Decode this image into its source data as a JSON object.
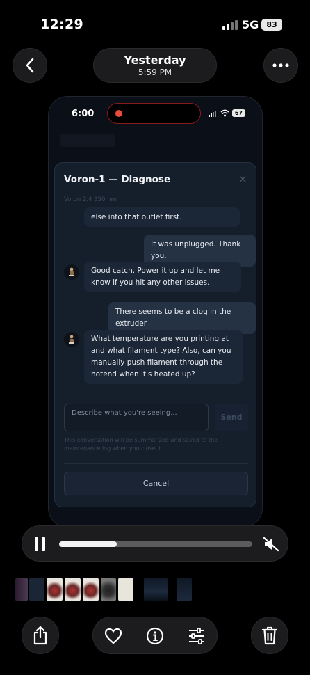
{
  "status_bar": {
    "time": "12:29",
    "network": "5G",
    "battery": "83"
  },
  "header": {
    "title": "Yesterday",
    "subtitle": "5:59 PM"
  },
  "icons": {
    "back": "chevron-left-icon",
    "more": "ellipsis-icon",
    "pause": "pause-icon",
    "mute": "speaker-muted-icon",
    "share": "share-icon",
    "favorite": "heart-icon",
    "info": "info-icon",
    "adjust": "sliders-icon",
    "delete": "trash-icon",
    "avatar": "printer-avatar-icon",
    "close": "close-icon"
  },
  "phone": {
    "status": {
      "time": "6:00",
      "battery": "67"
    },
    "dialog": {
      "title": "Voron-1 — Diagnose",
      "close": "×",
      "subtitle": "Voron 2.4 350mm",
      "messages": [
        {
          "role": "assistant",
          "text": "else into that outlet first."
        },
        {
          "role": "user",
          "text": "It was unplugged. Thank you."
        },
        {
          "role": "assistant",
          "text": "Good catch. Power it up and let me know if you hit any other issues."
        },
        {
          "role": "user",
          "text": "There seems to be a clog in the extruder"
        },
        {
          "role": "assistant",
          "text": "What temperature are you printing at and what filament type? Also, can you manually push filament through the hotend when it's heated up?"
        }
      ],
      "input_placeholder": "Describe what you're seeing...",
      "send_label": "Send",
      "notice": "This conversation will be summarized and saved to the maintenance log when you close it.",
      "cancel_label": "Cancel"
    }
  },
  "player": {
    "progress": 0.3
  },
  "colors": {
    "background": "#000000",
    "surface": "#1c1c1e",
    "modal": "#151e2b",
    "user_bubble": "#243244",
    "assistant_bubble": "#1b2636"
  }
}
